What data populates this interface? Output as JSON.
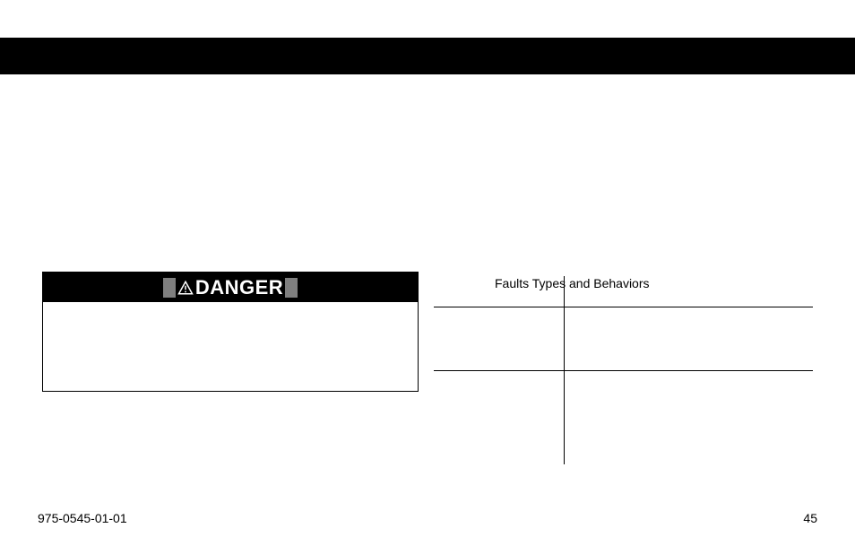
{
  "band": {},
  "danger": {
    "label": "DANGER",
    "body": ""
  },
  "table": {
    "prefix": "",
    "title": "Faults Types and Behaviors"
  },
  "footer": {
    "docnum": "975-0545-01-01",
    "page": "45"
  }
}
